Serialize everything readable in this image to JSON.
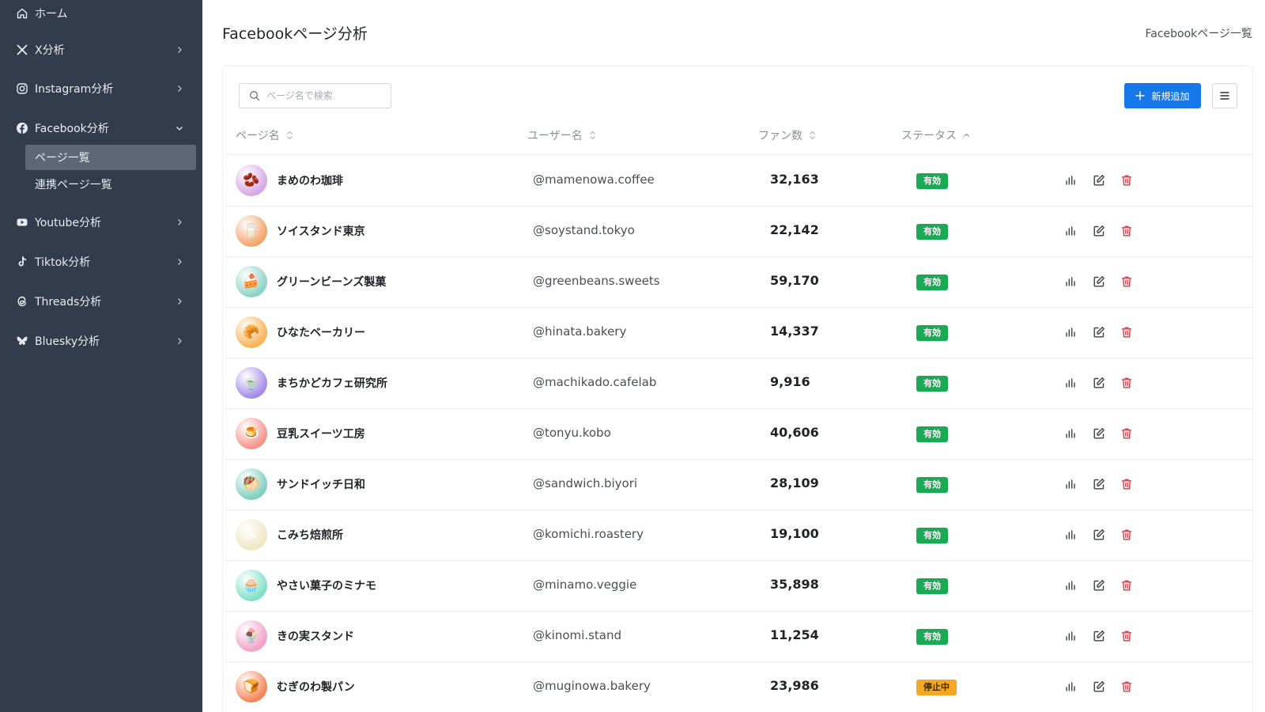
{
  "colors": {
    "sidebar_bg": "#323c4d",
    "sidebar_active": "#5d6778",
    "primary": "#1677e8",
    "status_active": "#1aaa55",
    "status_stopped": "#f5a623",
    "delete": "#e5383b"
  },
  "sidebar": {
    "items": [
      {
        "label": "ホーム",
        "icon": "home-icon"
      },
      {
        "label": "X分析",
        "icon": "x-logo-icon",
        "chevron": "chevron-right-icon"
      },
      {
        "label": "Instagram分析",
        "icon": "instagram-icon",
        "chevron": "chevron-right-icon"
      },
      {
        "label": "Facebook分析",
        "icon": "facebook-icon",
        "chevron": "chevron-down-icon",
        "expanded": true,
        "children": [
          {
            "label": "ページ一覧",
            "active": true
          },
          {
            "label": "連携ページ一覧",
            "active": false
          }
        ]
      },
      {
        "label": "Youtube分析",
        "icon": "youtube-icon",
        "chevron": "chevron-right-icon"
      },
      {
        "label": "Tiktok分析",
        "icon": "tiktok-icon",
        "chevron": "chevron-right-icon"
      },
      {
        "label": "Threads分析",
        "icon": "threads-icon",
        "chevron": "chevron-right-icon"
      },
      {
        "label": "Bluesky分析",
        "icon": "bluesky-icon",
        "chevron": "chevron-right-icon"
      }
    ]
  },
  "header": {
    "title": "Facebookページ分析",
    "breadcrumb": "Facebookページ一覧"
  },
  "toolbar": {
    "search_placeholder": "ページ名で検索",
    "search_value": "",
    "add_label": "新規追加"
  },
  "table": {
    "columns": [
      {
        "label": "ページ名",
        "sort": "none"
      },
      {
        "label": "ユーザー名",
        "sort": "none"
      },
      {
        "label": "ファン数",
        "sort": "none"
      },
      {
        "label": "ステータス",
        "sort": "ascending"
      }
    ],
    "rows": [
      {
        "name": "まめのわ珈琲",
        "username": "@mamenowa.coffee",
        "fans": "32,163",
        "status": "有効",
        "status_type": "active",
        "avatar_glyph": "🫘",
        "avatar_color": "#d9a7e8"
      },
      {
        "name": "ソイスタンド東京",
        "username": "@soystand.tokyo",
        "fans": "22,142",
        "status": "有効",
        "status_type": "active",
        "avatar_glyph": "🥛",
        "avatar_color": "#f4a36b"
      },
      {
        "name": "グリーンビーンズ製菓",
        "username": "@greenbeans.sweets",
        "fans": "59,170",
        "status": "有効",
        "status_type": "active",
        "avatar_glyph": "🍰",
        "avatar_color": "#8fd3c7"
      },
      {
        "name": "ひなたベーカリー",
        "username": "@hinata.bakery",
        "fans": "14,337",
        "status": "有効",
        "status_type": "active",
        "avatar_glyph": "🥐",
        "avatar_color": "#f7b357"
      },
      {
        "name": "まちかどカフェ研究所",
        "username": "@machikado.cafelab",
        "fans": "9,916",
        "status": "有効",
        "status_type": "active",
        "avatar_glyph": "🍵",
        "avatar_color": "#a58be8"
      },
      {
        "name": "豆乳スイーツ工房",
        "username": "@tonyu.kobo",
        "fans": "40,606",
        "status": "有効",
        "status_type": "active",
        "avatar_glyph": "🍮",
        "avatar_color": "#f7948a"
      },
      {
        "name": "サンドイッチ日和",
        "username": "@sandwich.biyori",
        "fans": "28,109",
        "status": "有効",
        "status_type": "active",
        "avatar_glyph": "🥙",
        "avatar_color": "#7fcfc0"
      },
      {
        "name": "こみち焙煎所",
        "username": "@komichi.roastery",
        "fans": "19,100",
        "status": "有効",
        "status_type": "active",
        "avatar_glyph": "☕",
        "avatar_color": "#efe6c4"
      },
      {
        "name": "やさい菓子のミナモ",
        "username": "@minamo.veggie",
        "fans": "35,898",
        "status": "有効",
        "status_type": "active",
        "avatar_glyph": "🧁",
        "avatar_color": "#7fe0c8"
      },
      {
        "name": "きの実スタンド",
        "username": "@kinomi.stand",
        "fans": "11,254",
        "status": "有効",
        "status_type": "active",
        "avatar_glyph": "🍨",
        "avatar_color": "#f0a3c6"
      },
      {
        "name": "むぎのわ製パン",
        "username": "@muginowa.bakery",
        "fans": "23,986",
        "status": "停止中",
        "status_type": "stopped",
        "avatar_glyph": "🍞",
        "avatar_color": "#f5845a"
      }
    ],
    "actions": [
      "bar-chart-icon",
      "edit-icon",
      "trash-icon"
    ]
  }
}
